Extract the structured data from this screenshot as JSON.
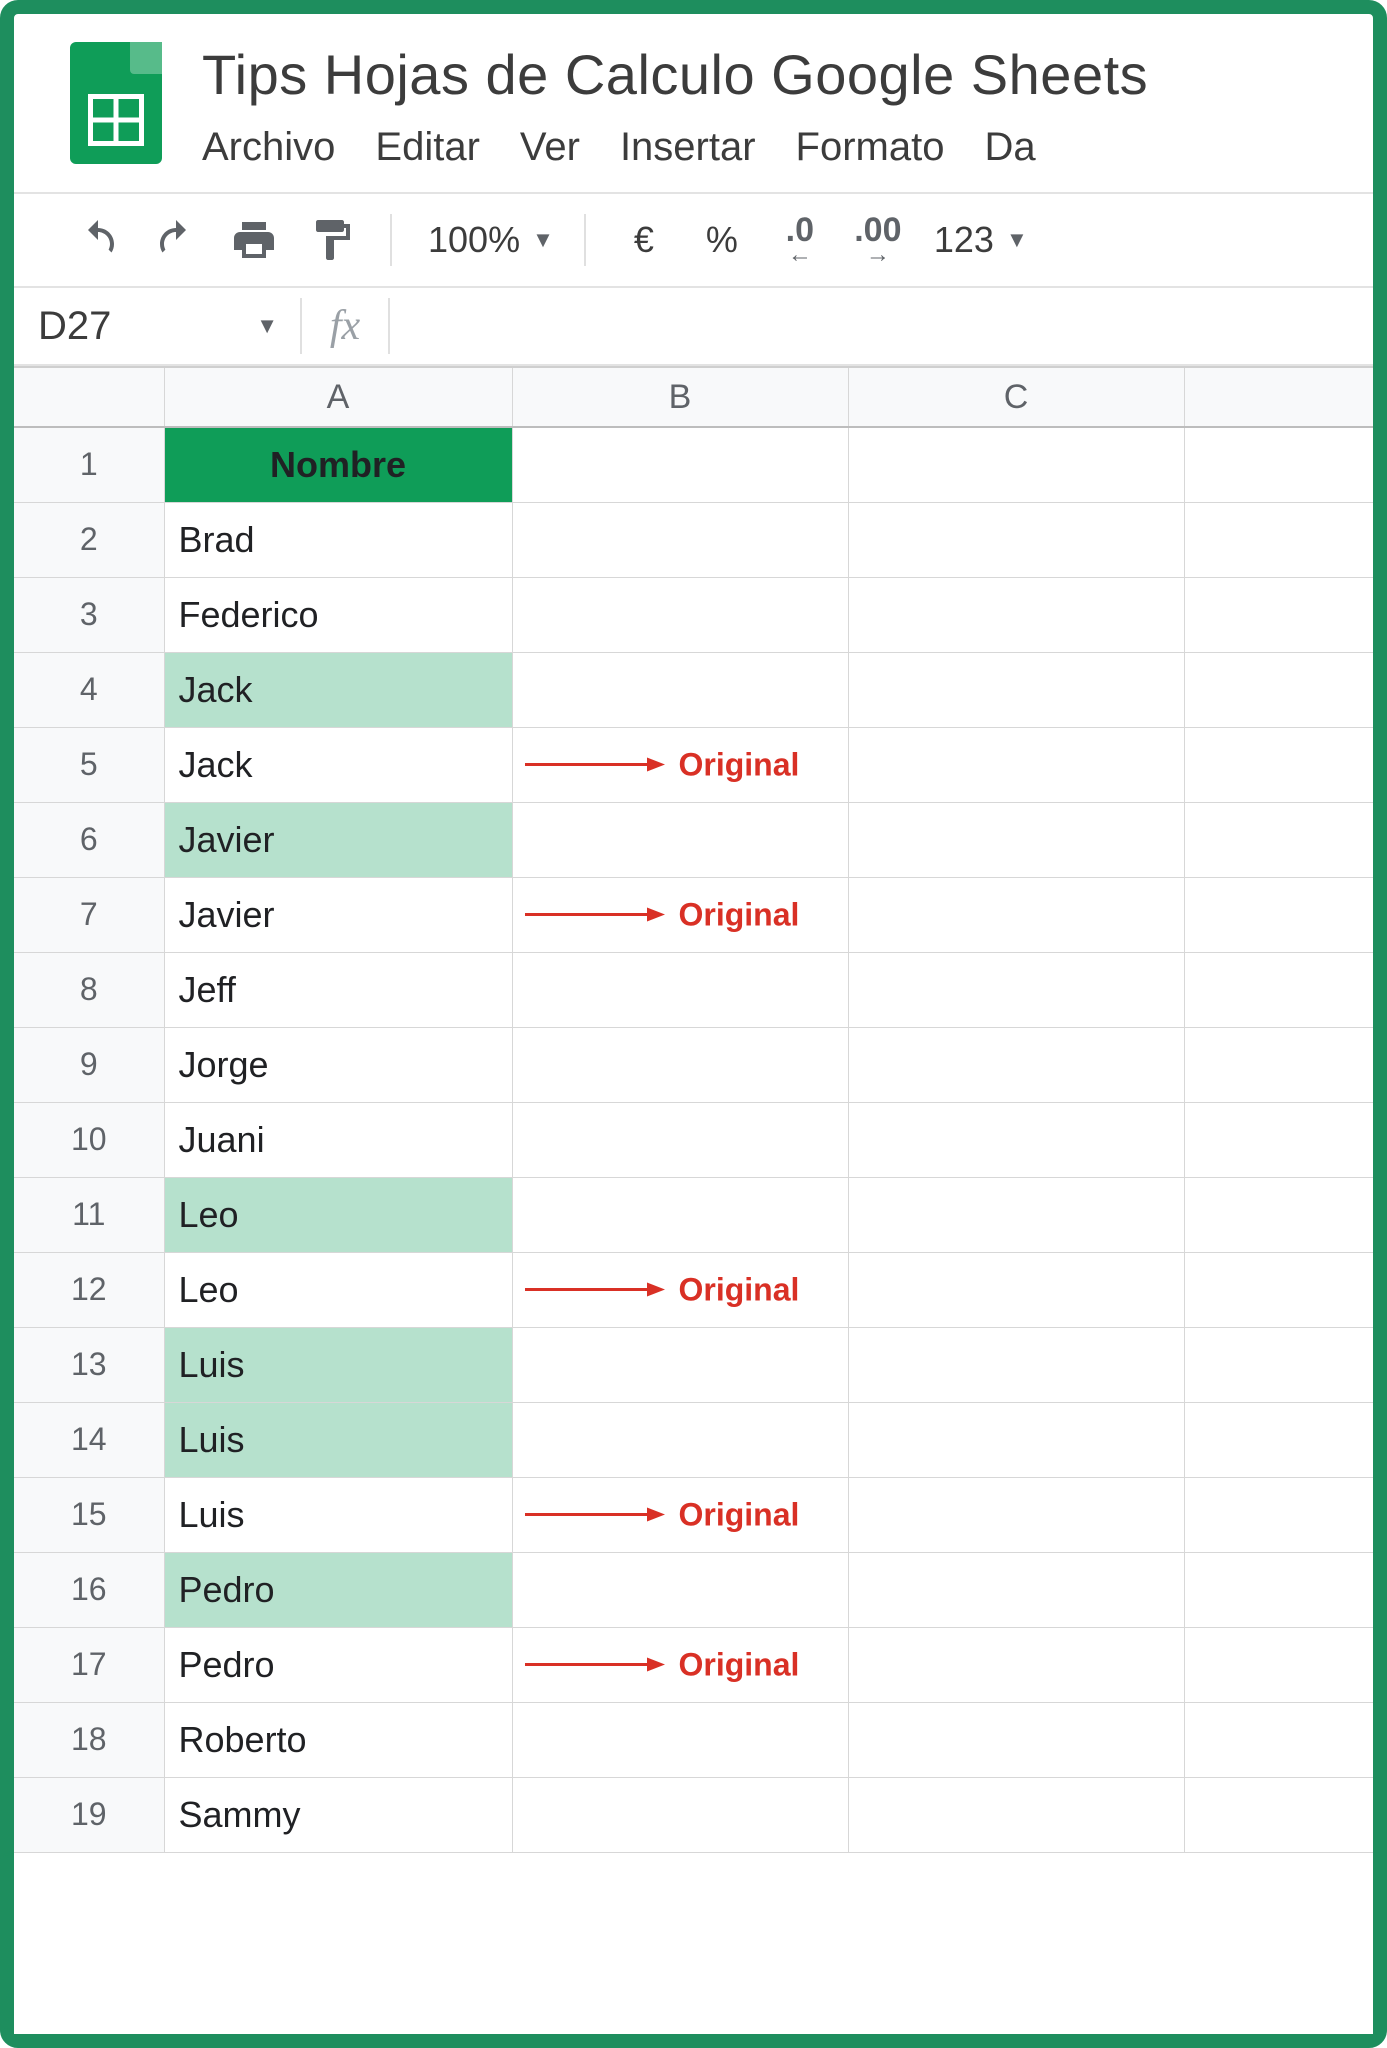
{
  "doc": {
    "title": "Tips Hojas de Calculo Google Sheets"
  },
  "menu": {
    "items": [
      "Archivo",
      "Editar",
      "Ver",
      "Insertar",
      "Formato",
      "Da"
    ]
  },
  "toolbar": {
    "zoom": "100%",
    "currency": "€",
    "percent": "%",
    "dec_dec": ".0",
    "dec_inc": ".00",
    "more_formats": "123"
  },
  "fx": {
    "cell_ref": "D27",
    "label": "fx",
    "value": ""
  },
  "columns": [
    "A",
    "B",
    "C"
  ],
  "header_cell": "Nombre",
  "annotation_label": "Original",
  "rows": [
    {
      "n": 1,
      "a": "Nombre",
      "header": true
    },
    {
      "n": 2,
      "a": "Brad"
    },
    {
      "n": 3,
      "a": "Federico"
    },
    {
      "n": 4,
      "a": "Jack",
      "highlight": true
    },
    {
      "n": 5,
      "a": "Jack",
      "annot": true
    },
    {
      "n": 6,
      "a": "Javier",
      "highlight": true
    },
    {
      "n": 7,
      "a": "Javier",
      "annot": true
    },
    {
      "n": 8,
      "a": "Jeff"
    },
    {
      "n": 9,
      "a": "Jorge"
    },
    {
      "n": 10,
      "a": "Juani"
    },
    {
      "n": 11,
      "a": "Leo",
      "highlight": true
    },
    {
      "n": 12,
      "a": "Leo",
      "annot": true
    },
    {
      "n": 13,
      "a": "Luis",
      "highlight": true
    },
    {
      "n": 14,
      "a": "Luis",
      "highlight": true
    },
    {
      "n": 15,
      "a": "Luis",
      "annot": true
    },
    {
      "n": 16,
      "a": "Pedro",
      "highlight": true
    },
    {
      "n": 17,
      "a": "Pedro",
      "annot": true
    },
    {
      "n": 18,
      "a": "Roberto"
    },
    {
      "n": 19,
      "a": "Sammy"
    }
  ]
}
